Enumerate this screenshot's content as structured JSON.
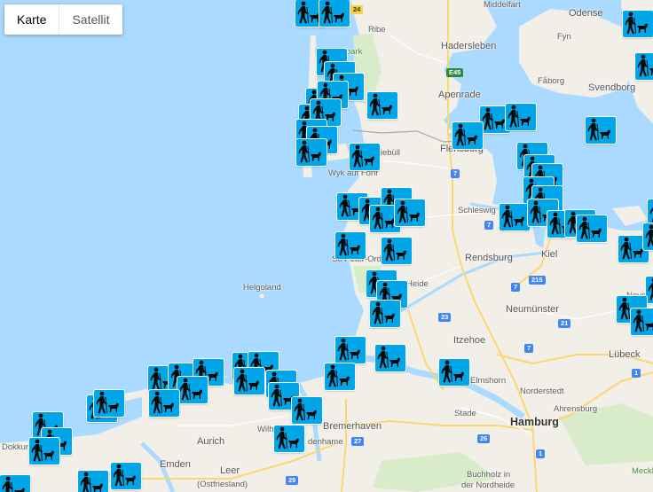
{
  "map_type_control": {
    "map": "Karte",
    "satellite": "Satellit"
  },
  "labels": {
    "middelfart": "Middelfart",
    "odense": "Odense",
    "ribe": "Ribe",
    "fyn": "Fyn",
    "haderslev": "Hadersleben",
    "nationalpark": "Nationalpark",
    "aabenraa": "Apenrade",
    "faborg": "Fåborg",
    "svendborg": "Svendborg",
    "flensburg": "Flensburg",
    "niebull": "Niebüll",
    "wyk": "Wyk auf Föhr",
    "schleswig": "Schleswig",
    "rendsburg": "Rendsburg",
    "kiel": "Kiel",
    "stpeter": "St. Peter-Ording",
    "heide": "Heide",
    "helgoland": "Helgoland",
    "neumuenster": "Neumünster",
    "itzehoe": "Itzehoe",
    "luebeck": "Lübeck",
    "neust": "Neust",
    "elmshorn": "Elmshorn",
    "norderstedt": "Norderstedt",
    "ahrensburg": "Ahrensburg",
    "stade": "Stade",
    "hamburg": "Hamburg",
    "bremerhaven": "Bremerhaven",
    "cuxhaven_part": "denhame",
    "wilhel_part": "Wilh",
    "aurich": "Aurich",
    "emden": "Emden",
    "leer": "Leer",
    "ostfriesland": "(Ostfriesland)",
    "buchholz": "Buchholz in",
    "nordheide": "der Nordheide",
    "meckl": "Meckl",
    "dokkum": "Dokkum"
  },
  "road_shields": [
    "24",
    "E45",
    "7",
    "7",
    "215",
    "7",
    "23",
    "21",
    "7",
    "27",
    "29",
    "1",
    "1",
    "26"
  ],
  "marker_icon": "hiker-with-dog-icon",
  "colors": {
    "water": "#aadaff",
    "land": "#f2efe9",
    "green": "#d8ecc9",
    "marker": "#00a6e8"
  }
}
